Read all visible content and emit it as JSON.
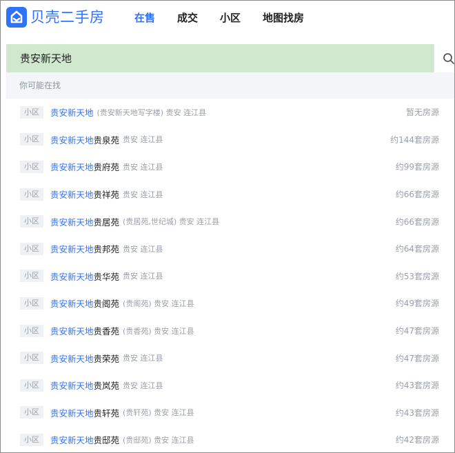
{
  "brand": {
    "name": "贝壳二手房",
    "color": "#3072f6",
    "icon": "beike-logo-icon"
  },
  "nav": [
    {
      "label": "在售",
      "active": true
    },
    {
      "label": "成交",
      "active": false
    },
    {
      "label": "小区",
      "active": false
    },
    {
      "label": "地图找房",
      "active": false
    }
  ],
  "search": {
    "value": "贵安新天地",
    "icon": "search-icon",
    "bg": "#cfe8ce"
  },
  "suggestions": {
    "header": "你可能在找",
    "items": [
      {
        "tag": "小区",
        "highlight": "贵安新天地",
        "rest": "",
        "meta": "(贵安新天地写字楼) 贵安 连江县",
        "count": "暂无房源"
      },
      {
        "tag": "小区",
        "highlight": "贵安新天地",
        "rest": "贵泉苑",
        "meta": "贵安 连江县",
        "count": "约144套房源"
      },
      {
        "tag": "小区",
        "highlight": "贵安新天地",
        "rest": "贵府苑",
        "meta": "贵安 连江县",
        "count": "约99套房源"
      },
      {
        "tag": "小区",
        "highlight": "贵安新天地",
        "rest": "贵祥苑",
        "meta": "贵安 连江县",
        "count": "约66套房源"
      },
      {
        "tag": "小区",
        "highlight": "贵安新天地",
        "rest": "贵居苑",
        "meta": "(贵居苑,世纪城) 贵安 连江县",
        "count": "约66套房源"
      },
      {
        "tag": "小区",
        "highlight": "贵安新天地",
        "rest": "贵邦苑",
        "meta": "贵安 连江县",
        "count": "约64套房源"
      },
      {
        "tag": "小区",
        "highlight": "贵安新天地",
        "rest": "贵华苑",
        "meta": "贵安 连江县",
        "count": "约53套房源"
      },
      {
        "tag": "小区",
        "highlight": "贵安新天地",
        "rest": "贵阁苑",
        "meta": "(贵阁苑) 贵安 连江县",
        "count": "约49套房源"
      },
      {
        "tag": "小区",
        "highlight": "贵安新天地",
        "rest": "贵香苑",
        "meta": "(贵香苑) 贵安 连江县",
        "count": "约47套房源"
      },
      {
        "tag": "小区",
        "highlight": "贵安新天地",
        "rest": "贵荣苑",
        "meta": "贵安 连江县",
        "count": "约47套房源"
      },
      {
        "tag": "小区",
        "highlight": "贵安新天地",
        "rest": "贵岚苑",
        "meta": "贵安 连江县",
        "count": "约43套房源"
      },
      {
        "tag": "小区",
        "highlight": "贵安新天地",
        "rest": "贵轩苑",
        "meta": "(贵轩苑) 贵安 连江县",
        "count": "约43套房源"
      },
      {
        "tag": "小区",
        "highlight": "贵安新天地",
        "rest": "贵邸苑",
        "meta": "(贵邸苑) 贵安 连江县",
        "count": "约42套房源"
      }
    ]
  }
}
